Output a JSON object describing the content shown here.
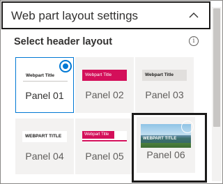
{
  "header": {
    "title": "Web part layout settings",
    "chevron_icon": "chevron-up-icon"
  },
  "section": {
    "title": "Select header layout",
    "info_icon": "info-icon",
    "info_glyph": "i"
  },
  "tiles": [
    {
      "label": "Panel 01",
      "thumb_text": "Webpart Title",
      "selected": true
    },
    {
      "label": "Panel 02",
      "thumb_text": "Webpart Title",
      "selected": false
    },
    {
      "label": "Panel 03",
      "thumb_text": "Webpart Title",
      "selected": false
    },
    {
      "label": "Panel 04",
      "thumb_text": "WEBPART TITLE",
      "selected": false
    },
    {
      "label": "Panel 05",
      "thumb_text": "Webpart Title",
      "selected": false
    },
    {
      "label": "Panel 06",
      "thumb_text": "WEBPART TITLE",
      "selected": false
    }
  ],
  "colors": {
    "accent": "#0078d4",
    "banner_pink": "#d40f5a",
    "border_dark": "#1b1a19"
  }
}
